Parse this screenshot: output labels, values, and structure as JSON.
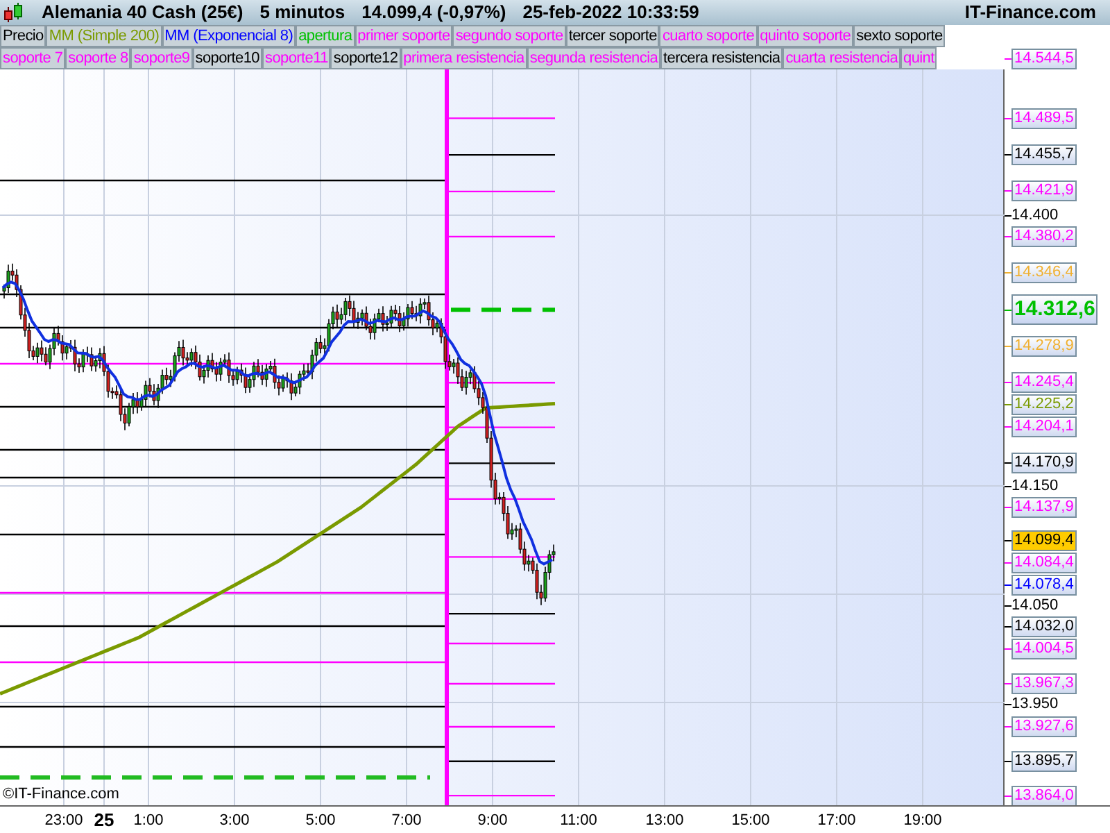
{
  "header": {
    "title": "Alemania 40 Cash (25€)",
    "timeframe": "5 minutos",
    "quote": "14.099,4 (-0,97%)",
    "datetime": "25-feb-2022 10:33:59",
    "brand": "IT-Finance.com"
  },
  "legend_rows": [
    [
      {
        "label": "Precio",
        "color": "#000000"
      },
      {
        "label": "MM (Simple 200)",
        "color": "#7a9a00"
      },
      {
        "label": "MM (Exponencial 8)",
        "color": "#0000ff"
      },
      {
        "label": "apertura",
        "color": "#00c000"
      },
      {
        "label": "primer soporte",
        "color": "#ff00ff"
      },
      {
        "label": "segundo soporte",
        "color": "#ff00ff"
      },
      {
        "label": "tercer soporte",
        "color": "#000000"
      },
      {
        "label": "cuarto soporte",
        "color": "#ff00ff"
      },
      {
        "label": "quinto soporte",
        "color": "#ff00ff"
      },
      {
        "label": "sexto soporte",
        "color": "#000000"
      }
    ],
    [
      {
        "label": "soporte 7",
        "color": "#ff00ff"
      },
      {
        "label": "soporte 8",
        "color": "#ff00ff"
      },
      {
        "label": "soporte9",
        "color": "#ff00ff"
      },
      {
        "label": "soporte10",
        "color": "#000000"
      },
      {
        "label": "soporte11",
        "color": "#ff00ff"
      },
      {
        "label": "soporte12",
        "color": "#000000"
      },
      {
        "label": "primera resistencia",
        "color": "#ff00ff"
      },
      {
        "label": "segunda resistencia",
        "color": "#ff00ff"
      },
      {
        "label": "tercera resistencia",
        "color": "#000000"
      },
      {
        "label": "cuarta resistencia",
        "color": "#ff00ff"
      },
      {
        "label": "quint",
        "color": "#ff00ff"
      }
    ]
  ],
  "price_ticks": [
    "14.400",
    "14.150",
    "14.050",
    "13.950"
  ],
  "levels": [
    {
      "value": "14.544,5",
      "kind": "level",
      "color": "#ff00ff"
    },
    {
      "value": "14.489,5",
      "kind": "level",
      "color": "#ff00ff"
    },
    {
      "value": "14.455,7",
      "kind": "level",
      "color": "#000000"
    },
    {
      "value": "14.421,9",
      "kind": "level",
      "color": "#ff00ff"
    },
    {
      "value": "14.380,2",
      "kind": "level",
      "color": "#ff00ff"
    },
    {
      "value": "14.346,4",
      "kind": "marker",
      "color": "#f0b030"
    },
    {
      "value": "14.312,6",
      "kind": "open",
      "color": "#00c000"
    },
    {
      "value": "14.278,9",
      "kind": "marker",
      "color": "#f0b030"
    },
    {
      "value": "14.245,4",
      "kind": "level",
      "color": "#ff00ff"
    },
    {
      "value": "14.225,2",
      "kind": "indicator",
      "color": "#7a9a00"
    },
    {
      "value": "14.204,1",
      "kind": "level",
      "color": "#ff00ff"
    },
    {
      "value": "14.170,9",
      "kind": "level",
      "color": "#000000"
    },
    {
      "value": "14.137,9",
      "kind": "level",
      "color": "#ff00ff"
    },
    {
      "value": "14.099,4",
      "kind": "last",
      "color": "#ffcc00"
    },
    {
      "value": "14.084,4",
      "kind": "level",
      "color": "#ff00ff"
    },
    {
      "value": "14.078,4",
      "kind": "indicator",
      "color": "#0000ff"
    },
    {
      "value": "14.032,0",
      "kind": "level",
      "color": "#000000"
    },
    {
      "value": "14.004,5",
      "kind": "level",
      "color": "#ff00ff"
    },
    {
      "value": "13.967,3",
      "kind": "level",
      "color": "#ff00ff"
    },
    {
      "value": "13.927,6",
      "kind": "level",
      "color": "#ff00ff"
    },
    {
      "value": "13.895,7",
      "kind": "level",
      "color": "#000000"
    },
    {
      "value": "13.864,0",
      "kind": "level",
      "color": "#ff00ff"
    }
  ],
  "copyright": "©IT-Finance.com",
  "time_axis": [
    {
      "label": "23:00",
      "kind": "time"
    },
    {
      "label": "25",
      "kind": "date"
    },
    {
      "label": "1:00",
      "kind": "time"
    },
    {
      "label": "3:00",
      "kind": "time"
    },
    {
      "label": "5:00",
      "kind": "time"
    },
    {
      "label": "7:00",
      "kind": "time"
    },
    {
      "label": "9:00",
      "kind": "time"
    },
    {
      "label": "11:00",
      "kind": "time"
    },
    {
      "label": "13:00",
      "kind": "time"
    },
    {
      "label": "15:00",
      "kind": "time"
    },
    {
      "label": "17:00",
      "kind": "time"
    },
    {
      "label": "19:00",
      "kind": "time"
    }
  ]
}
